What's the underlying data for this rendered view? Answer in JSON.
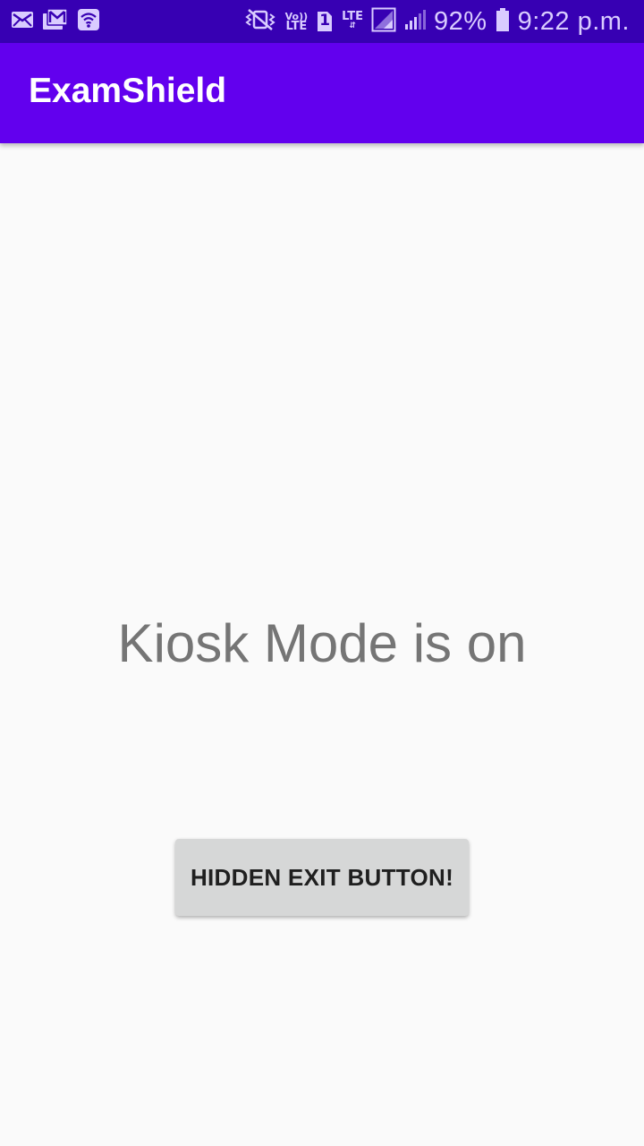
{
  "status_bar": {
    "left_icons": [
      "email-icon",
      "gmail-icon",
      "wifi-hotspot-icon"
    ],
    "right_icons": [
      "vibrate-icon",
      "volte-icon",
      "sim-1-icon",
      "lte-data-icon",
      "signal-sim1-icon",
      "signal-sim2-icon",
      "battery-icon"
    ],
    "volte_top": "Vo))",
    "volte_bottom": "LTE",
    "sim_number": "1",
    "lte_label": "LTE",
    "battery_percent": "92%",
    "time": "9:22 p.m.",
    "colors": {
      "background": "#3700b3",
      "icon": "#d9ccff"
    }
  },
  "app_bar": {
    "title": "ExamShield",
    "color": "#6200ee"
  },
  "main": {
    "message": "Kiosk Mode is on",
    "exit_button_label": "HIDDEN EXIT BUTTON!"
  },
  "colors": {
    "background": "#fafafa",
    "message_text": "#757575",
    "button_bg": "#d6d7d7"
  }
}
